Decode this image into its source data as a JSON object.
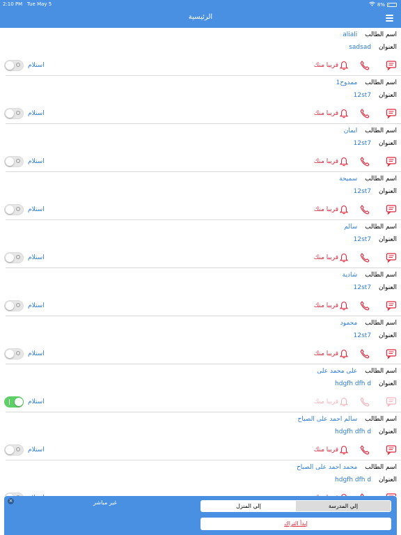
{
  "status": {
    "time": "2:10 PM",
    "date": "Tue May 5",
    "battery": "8%"
  },
  "nav": {
    "title": "الرئيسية"
  },
  "labels": {
    "student": "اسم الطالب",
    "address": "العنوان",
    "near": "قريبا منك",
    "receive": "استلام"
  },
  "students": [
    {
      "name": "aliali",
      "address": "sadsad",
      "received": false,
      "disabled": false
    },
    {
      "name": "ممدوح1",
      "address": "12st7",
      "received": false,
      "disabled": false
    },
    {
      "name": "ايمان",
      "address": "12st7",
      "received": false,
      "disabled": false
    },
    {
      "name": "سميحة",
      "address": "12st7",
      "received": false,
      "disabled": false
    },
    {
      "name": "سالم",
      "address": "12st7",
      "received": false,
      "disabled": false
    },
    {
      "name": "شادية",
      "address": "12st7",
      "received": false,
      "disabled": false
    },
    {
      "name": "محمود",
      "address": "12st7",
      "received": false,
      "disabled": false
    },
    {
      "name": "على محمد على",
      "address": "hdgfh dfh d",
      "received": true,
      "disabled": true
    },
    {
      "name": "سالم احمد على الصباح",
      "address": "hdgfh dfh d",
      "received": false,
      "disabled": false
    },
    {
      "name": "محمد احمد على الصباح",
      "address": "hdgfh dfh d",
      "received": false,
      "disabled": false
    }
  ],
  "bottom": {
    "status": "غير مباشر",
    "close": "×",
    "to_school": "إلي المدرسة",
    "to_home": "إلي المنزل",
    "start": "إبدأ التراك"
  },
  "colors": {
    "accent": "#4a90e2",
    "danger": "#e0263b",
    "link": "#2a7bd6",
    "toggle_on": "#5fd068"
  }
}
